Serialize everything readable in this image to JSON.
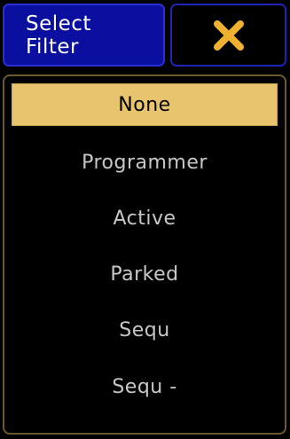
{
  "header": {
    "title_line1": "Select",
    "title_line2": "Filter",
    "close_icon": "close-x-icon",
    "close_color": "#f0b030"
  },
  "options": [
    {
      "label": "None",
      "selected": true
    },
    {
      "label": "Programmer",
      "selected": false
    },
    {
      "label": "Active",
      "selected": false
    },
    {
      "label": "Parked",
      "selected": false
    },
    {
      "label": "Sequ",
      "selected": false
    },
    {
      "label": "Sequ -",
      "selected": false
    }
  ],
  "colors": {
    "title_bg": "#0a0fa0",
    "selected_bg": "#e8c46f",
    "option_text": "#c8c8c8"
  }
}
